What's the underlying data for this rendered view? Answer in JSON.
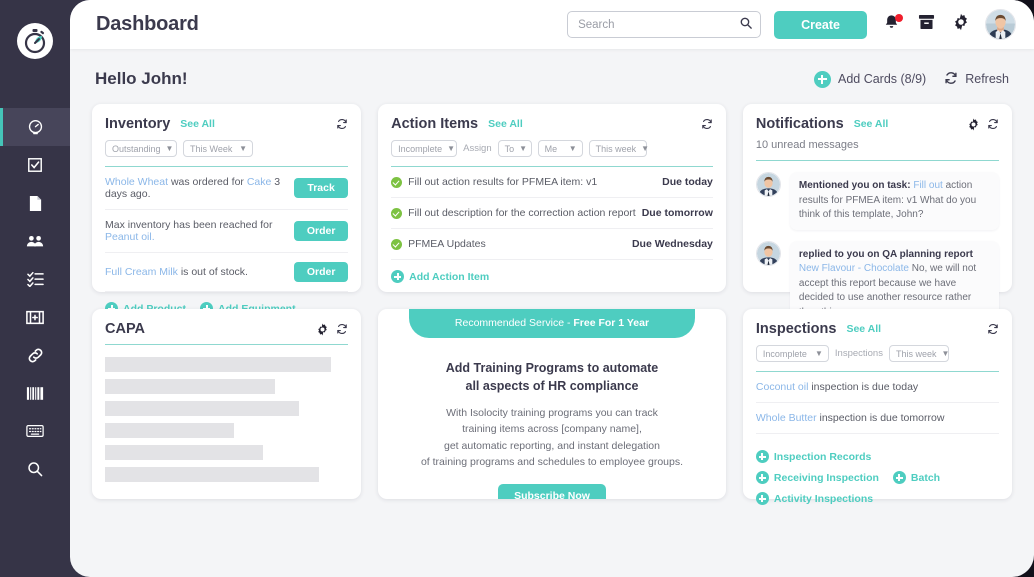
{
  "brand": {
    "accent": "#4ecdc0",
    "sidebar_bg": "#363447",
    "page_bg": "#f4f5f7",
    "link_blue": "#8bb7e8",
    "green": "#7dc242",
    "badge_red": "#f01e2c"
  },
  "header": {
    "title": "Dashboard",
    "search": {
      "value": "",
      "placeholder": "Search"
    },
    "create_label": "Create",
    "icons": [
      "bell-icon",
      "archive-icon",
      "gear-icon",
      "avatar"
    ]
  },
  "sidebar": {
    "logo": "stopwatch-logo",
    "items": [
      {
        "name": "dashboard",
        "icon": "gauge-icon",
        "active": true
      },
      {
        "name": "tasks",
        "icon": "checkbox-icon",
        "active": false
      },
      {
        "name": "documents",
        "icon": "document-icon",
        "active": false
      },
      {
        "name": "people",
        "icon": "people-icon",
        "active": false
      },
      {
        "name": "checklists",
        "icon": "list-check-icon",
        "active": false
      },
      {
        "name": "inspections",
        "icon": "id-card-icon",
        "active": false
      },
      {
        "name": "links",
        "icon": "chain-link-icon",
        "active": false
      },
      {
        "name": "reports",
        "icon": "barcode-icon",
        "active": false
      },
      {
        "name": "keyboard",
        "icon": "keyboard-icon",
        "active": false
      },
      {
        "name": "search",
        "icon": "magnifier-icon",
        "active": false
      }
    ]
  },
  "greeting": "Hello John!",
  "page_actions": {
    "add_cards": "Add Cards (8/9)",
    "refresh": "Refresh"
  },
  "cards": {
    "inventory": {
      "title": "Inventory",
      "see_all": "See All",
      "filters": [
        {
          "label": "Outstanding"
        },
        {
          "label": "This Week"
        }
      ],
      "rows": [
        {
          "pre": "",
          "link1": "Whole Wheat",
          "mid": " was ordered for ",
          "link2": "Cake",
          "post": " 3 days ago.",
          "action": "Track"
        },
        {
          "pre": "Max inventory has been reached for ",
          "link1": "",
          "mid": "",
          "link2": "Peanut oil.",
          "post": "",
          "action": "Order"
        },
        {
          "pre": "",
          "link1": "Full Cream Milk",
          "mid": " is out of stock.",
          "link2": "",
          "post": "",
          "action": "Order"
        }
      ],
      "add_links": [
        "Add Product",
        "Add Equipment"
      ]
    },
    "action_items": {
      "title": "Action Items",
      "see_all": "See All",
      "filters": [
        {
          "label": "Incomplete"
        },
        {
          "label": "To"
        },
        {
          "label": "Me"
        },
        {
          "label": "This week"
        }
      ],
      "assign_label": "Assign",
      "rows": [
        {
          "text": "Fill out action results for PFMEA item: v1",
          "due": "Due today"
        },
        {
          "text": "Fill out description for the correction action report",
          "due": "Due tomorrow"
        },
        {
          "text": "PFMEA Updates",
          "due": "Due Wednesday"
        }
      ],
      "add_link": "Add Action Item"
    },
    "notifications": {
      "title": "Notifications",
      "see_all": "See All",
      "unread": "10 unread messages",
      "items": [
        {
          "bold": "Mentioned you on task:",
          "link": " Fill out",
          "rest": " action results for PFMEA item: v1 What do you think of this template, John?"
        },
        {
          "bold": "replied to you on QA planning report",
          "link": " New Flavour - Chocolate",
          "rest": " No, we will not accept this report because we have decided to use another resource rather than this ..."
        }
      ]
    },
    "capa": {
      "title": "CAPA",
      "skeleton_widths": [
        "93%",
        "70%",
        "80%",
        "53%",
        "65%",
        "88%"
      ]
    },
    "promo": {
      "banner_pre": "Recommended Service - ",
      "banner_bold": "Free For 1 Year",
      "heading_line1": "Add Training Programs to automate",
      "heading_line2": "all aspects of HR compliance",
      "body_line1": "With Isolocity training programs you can track",
      "body_line2": "training items across [company name],",
      "body_line3": "get automatic reporting, and instant delegation",
      "body_line4": "of training programs and schedules to employee groups.",
      "cta": "Subscribe Now"
    },
    "inspections": {
      "title": "Inspections",
      "see_all": "See All",
      "filters": [
        {
          "label": "Incomplete"
        },
        {
          "label": "This week"
        }
      ],
      "mid_label": "Inspections",
      "rows": [
        {
          "link": "Coconut oil",
          "text": " inspection is due today"
        },
        {
          "link": "Whole Butter",
          "text": " inspection is due tomorrow"
        }
      ],
      "add_links": [
        "Inspection Records",
        "Receiving Inspection",
        "Batch",
        "Activity Inspections"
      ]
    }
  }
}
